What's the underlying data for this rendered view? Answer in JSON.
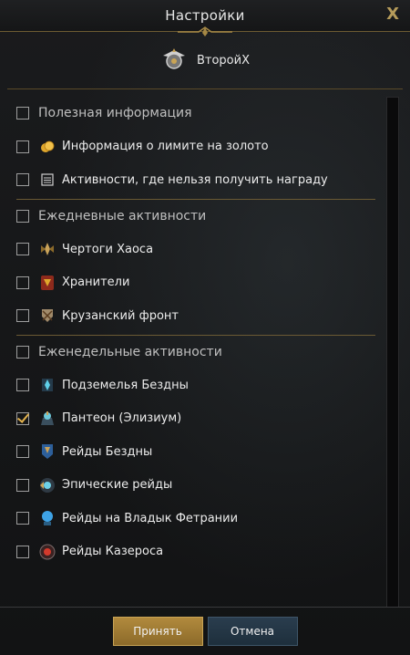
{
  "window": {
    "title": "Настройки",
    "close_label": "X"
  },
  "profile": {
    "name": "ВторойX",
    "icon": "emblem-icon"
  },
  "sections": [
    {
      "label": "Полезная информация",
      "items": [
        {
          "label": "Информация о лимите на золото",
          "icon": "gold-coins-icon",
          "checked": false
        },
        {
          "label": "Активности, где нельзя получить награду",
          "icon": "list-icon",
          "checked": false
        }
      ]
    },
    {
      "label": "Ежедневные активности",
      "items": [
        {
          "label": "Чертоги Хаоса",
          "icon": "chaos-dungeon-icon",
          "checked": false
        },
        {
          "label": "Хранители",
          "icon": "guardian-icon",
          "checked": false
        },
        {
          "label": "Крузанский фронт",
          "icon": "kurzan-front-icon",
          "checked": false
        }
      ]
    },
    {
      "label": "Еженедельные активности",
      "items": [
        {
          "label": "Подземелья Бездны",
          "icon": "abyss-dungeon-icon",
          "checked": false
        },
        {
          "label": "Пантеон (Элизиум)",
          "icon": "pantheon-icon",
          "checked": true
        },
        {
          "label": "Рейды Бездны",
          "icon": "abyss-raid-icon",
          "checked": false
        },
        {
          "label": "Эпические рейды",
          "icon": "epic-raid-icon",
          "checked": false
        },
        {
          "label": "Рейды на Владык Фетрании",
          "icon": "legion-raid-icon",
          "checked": false
        },
        {
          "label": "Рейды Казероса",
          "icon": "kazeros-raid-icon",
          "checked": false
        }
      ]
    }
  ],
  "footer": {
    "accept_label": "Принять",
    "cancel_label": "Отмена"
  },
  "colors": {
    "accent_gold": "#b18a3d",
    "cancel_blue": "#2a3d4e",
    "check_color": "#e3b24c"
  }
}
